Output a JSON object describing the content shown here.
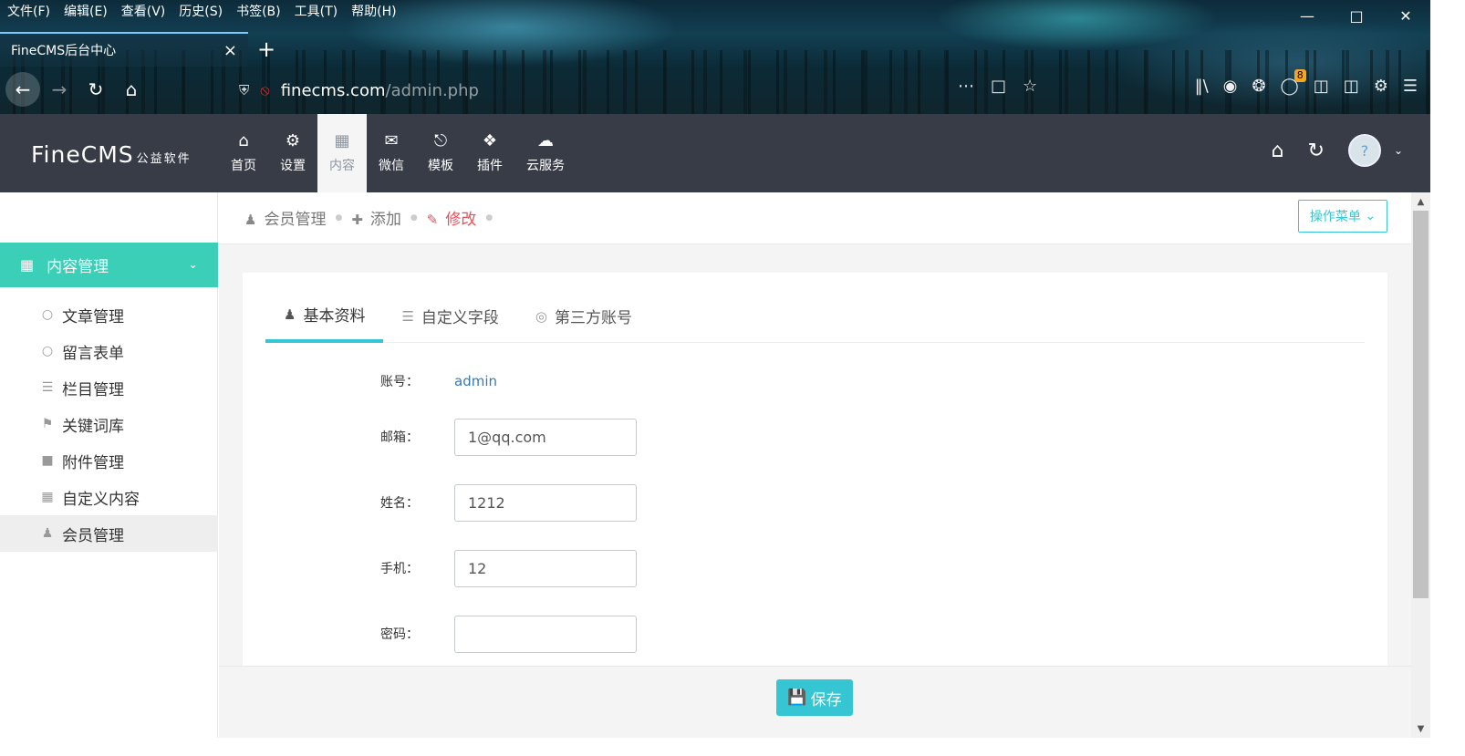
{
  "browser": {
    "menu": [
      "文件(F)",
      "编辑(E)",
      "查看(V)",
      "历史(S)",
      "书签(B)",
      "工具(T)",
      "帮助(H)"
    ],
    "tab_title": "FineCMS后台中心",
    "url_domain": "finecms.com",
    "url_path": "/admin.php",
    "extension_badge": "8"
  },
  "app": {
    "logo": "FineCMS",
    "logo_sub": "公益软件",
    "nav": [
      {
        "label": "首页",
        "icon": "home-icon"
      },
      {
        "label": "设置",
        "icon": "gear-icon"
      },
      {
        "label": "内容",
        "icon": "grid-icon",
        "active": true
      },
      {
        "label": "微信",
        "icon": "wechat-icon"
      },
      {
        "label": "模板",
        "icon": "html5-icon"
      },
      {
        "label": "插件",
        "icon": "puzzle-icon"
      },
      {
        "label": "云服务",
        "icon": "cloud-icon"
      }
    ],
    "avatar_text": "?"
  },
  "sidebar": {
    "section": "内容管理",
    "items": [
      {
        "label": "文章管理",
        "icon": "circle-icon"
      },
      {
        "label": "留言表单",
        "icon": "circle-icon"
      },
      {
        "label": "栏目管理",
        "icon": "list-icon"
      },
      {
        "label": "关键词库",
        "icon": "tag-icon"
      },
      {
        "label": "附件管理",
        "icon": "folder-icon"
      },
      {
        "label": "自定义内容",
        "icon": "grid-icon"
      },
      {
        "label": "会员管理",
        "icon": "user-icon",
        "active": true
      }
    ]
  },
  "breadcrumb": {
    "items": [
      "会员管理",
      "添加",
      "修改"
    ],
    "op_menu": "操作菜单"
  },
  "tabs": [
    "基本资料",
    "自定义字段",
    "第三方账号"
  ],
  "form": {
    "account_label": "账号：",
    "account_value": "admin",
    "email_label": "邮箱：",
    "email_value": "1@qq.com",
    "name_label": "姓名：",
    "name_value": "1212",
    "phone_label": "手机：",
    "phone_value": "12",
    "password_label": "密码：",
    "password_value": ""
  },
  "save_label": "保存"
}
